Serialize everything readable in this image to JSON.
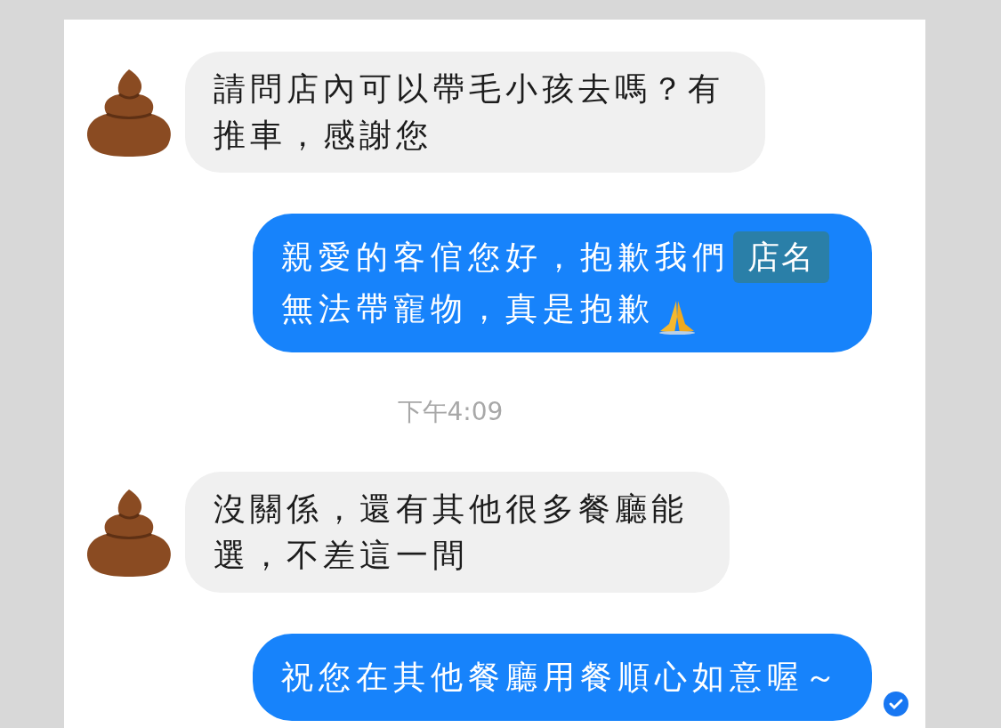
{
  "messages": [
    {
      "kind": "incoming",
      "text": "請問店內可以帶毛小孩去嗎？有推車，感謝您"
    },
    {
      "kind": "outgoing",
      "text": "親愛的客倌您好，抱歉我們",
      "overlay_label": "店名",
      "text_after": "無法帶寵物，真是抱歉",
      "trailing_emoji": true,
      "read": false
    },
    {
      "kind": "timestamp",
      "text": "下午4:09"
    },
    {
      "kind": "incoming",
      "text": "沒關係，還有其他很多餐廳能選，不差這一間"
    },
    {
      "kind": "outgoing",
      "text": "祝您在其他餐廳用餐順心如意喔～",
      "read": true
    }
  ]
}
